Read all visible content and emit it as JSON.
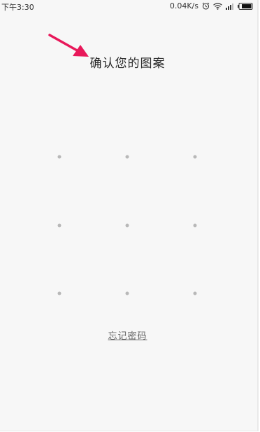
{
  "status_bar": {
    "time": "下午3:30",
    "network_speed": "0.04K/s",
    "icons": [
      "alarm-icon",
      "wifi-icon",
      "signal-icon",
      "battery-icon"
    ]
  },
  "lock_screen": {
    "title": "确认您的图案",
    "forgot_password": "忘记密码",
    "pattern_dots": 9
  },
  "colors": {
    "annotation_arrow": "#e8185a",
    "background": "#f7f7f7",
    "dot": "#b8b8b8"
  }
}
